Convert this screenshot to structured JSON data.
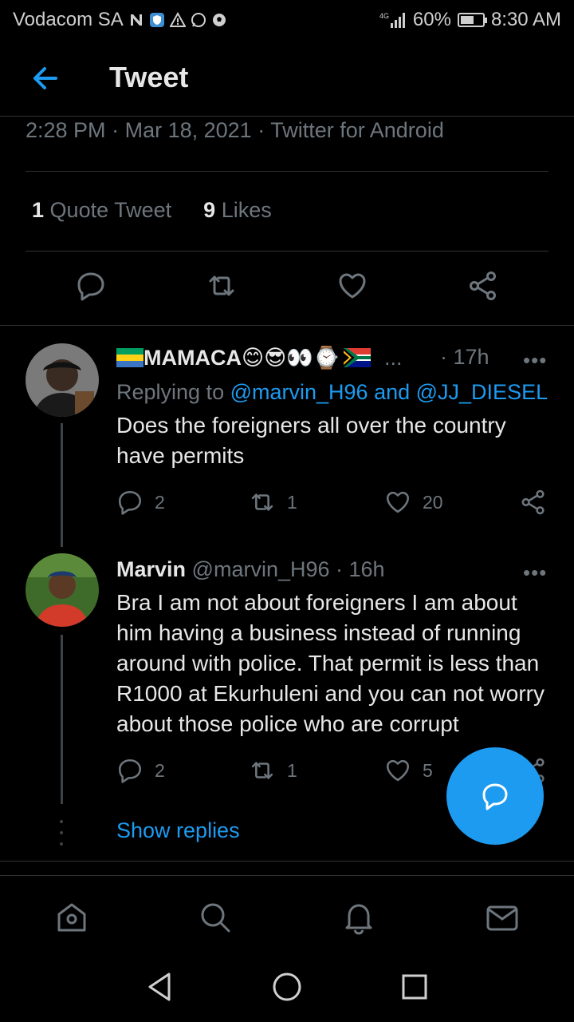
{
  "status_bar": {
    "carrier": "Vodacom SA",
    "network": "4G",
    "battery": "60%",
    "battery_level": 0.6,
    "time": "8:30 AM"
  },
  "header": {
    "title": "Tweet",
    "back_icon": "arrow-left-icon"
  },
  "tweet_meta": {
    "time": "2:28 PM",
    "date": "Mar 18, 2021",
    "source": "Twitter for Android",
    "separator": "·"
  },
  "stats": {
    "quote_count": "1",
    "quote_label": "Quote Tweet",
    "likes_count": "9",
    "likes_label": "Likes"
  },
  "actions": [
    "reply-icon",
    "retweet-icon",
    "like-icon",
    "share-icon"
  ],
  "replies": [
    {
      "name": "MAMACA",
      "name_emojis": "😊😎👀⌚",
      "ellipsis": "...",
      "age": "· 17h",
      "replying_prefix": "Replying to",
      "replying_to": "@marvin_H96 and @JJ_DIESEL",
      "text": "Does the foreigners all over the country have permits",
      "reply_count": "2",
      "retweet_count": "1",
      "like_count": "20"
    },
    {
      "name": "Marvin",
      "handle": "@marvin_H96",
      "age": "· 16h",
      "text": "Bra I am not about foreigners I am about him having a business instead of running around with police. That permit is less than R1000 at Ekurhuleni and you can not worry about those police who are corrupt",
      "reply_count": "2",
      "retweet_count": "1",
      "like_count": "5"
    }
  ],
  "show_replies": "Show replies",
  "more_label": "•••",
  "bottom_nav": [
    "home-icon",
    "search-icon",
    "notifications-icon",
    "messages-icon"
  ],
  "system_nav": [
    "back-triangle-icon",
    "home-circle-icon",
    "recents-square-icon"
  ],
  "colors": {
    "accent": "#1d9bf0",
    "background": "#000000",
    "muted": "#6e767d",
    "divider": "#2f3336"
  }
}
